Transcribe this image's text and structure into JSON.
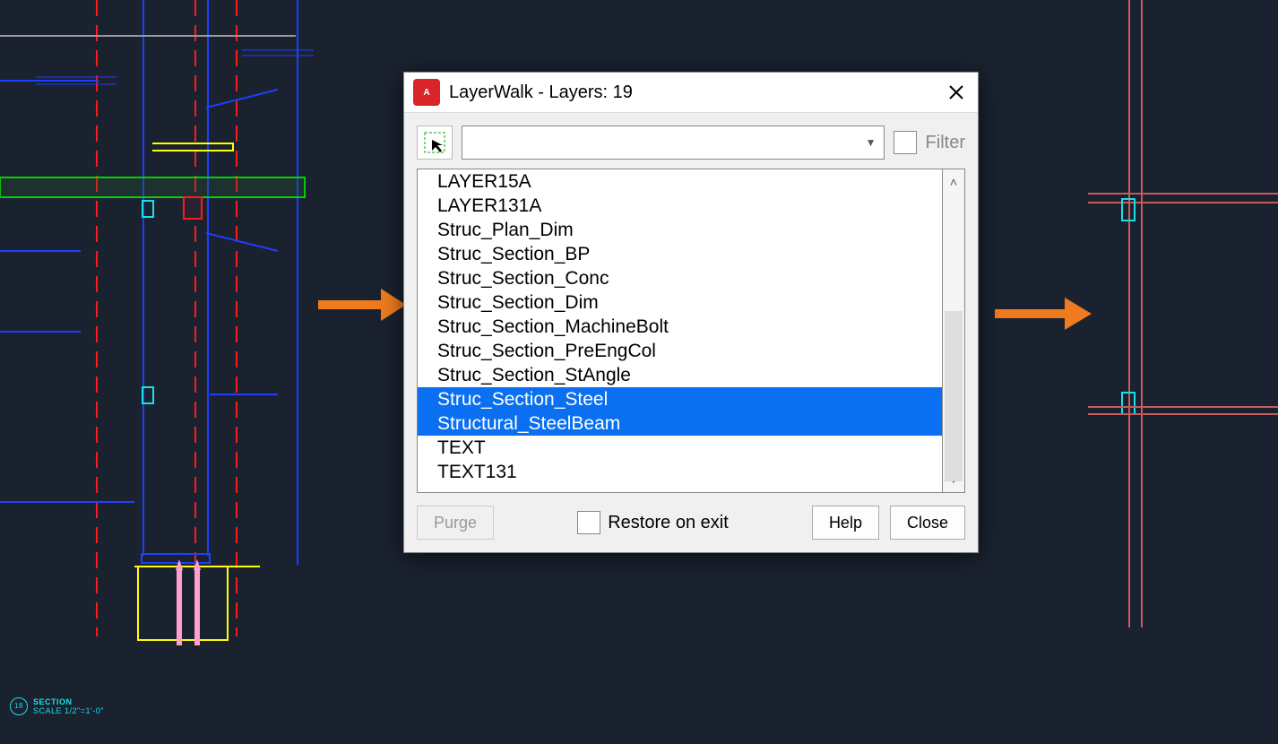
{
  "dialog": {
    "title": "LayerWalk - Layers: 19",
    "app_icon_text": "A",
    "filter_label": "Filter",
    "combo_value": "",
    "restore_label": "Restore on exit",
    "buttons": {
      "purge": "Purge",
      "help": "Help",
      "close": "Close"
    }
  },
  "layers": [
    {
      "name": "LAYER15A",
      "selected": false
    },
    {
      "name": "LAYER131A",
      "selected": false
    },
    {
      "name": "Struc_Plan_Dim",
      "selected": false
    },
    {
      "name": "Struc_Section_BP",
      "selected": false
    },
    {
      "name": "Struc_Section_Conc",
      "selected": false
    },
    {
      "name": "Struc_Section_Dim",
      "selected": false
    },
    {
      "name": "Struc_Section_MachineBolt",
      "selected": false
    },
    {
      "name": "Struc_Section_PreEngCol",
      "selected": false
    },
    {
      "name": "Struc_Section_StAngle",
      "selected": false
    },
    {
      "name": "Struc_Section_Steel",
      "selected": true
    },
    {
      "name": "Structural_SteelBeam",
      "selected": true
    },
    {
      "name": "TEXT",
      "selected": false
    },
    {
      "name": "TEXT131",
      "selected": false
    }
  ],
  "section_tag": {
    "num": "18",
    "line1": "SECTION",
    "line2": "SCALE 1/2\"=1'-0\""
  },
  "colors": {
    "arrow": "#f07b1e",
    "blue": "#1e3fff",
    "red": "#ff1a1a",
    "yellow": "#ffff00",
    "green": "#00e000",
    "cyan": "#19e0e8",
    "pink": "#ff9ecf",
    "steel": "#c85a5a"
  }
}
